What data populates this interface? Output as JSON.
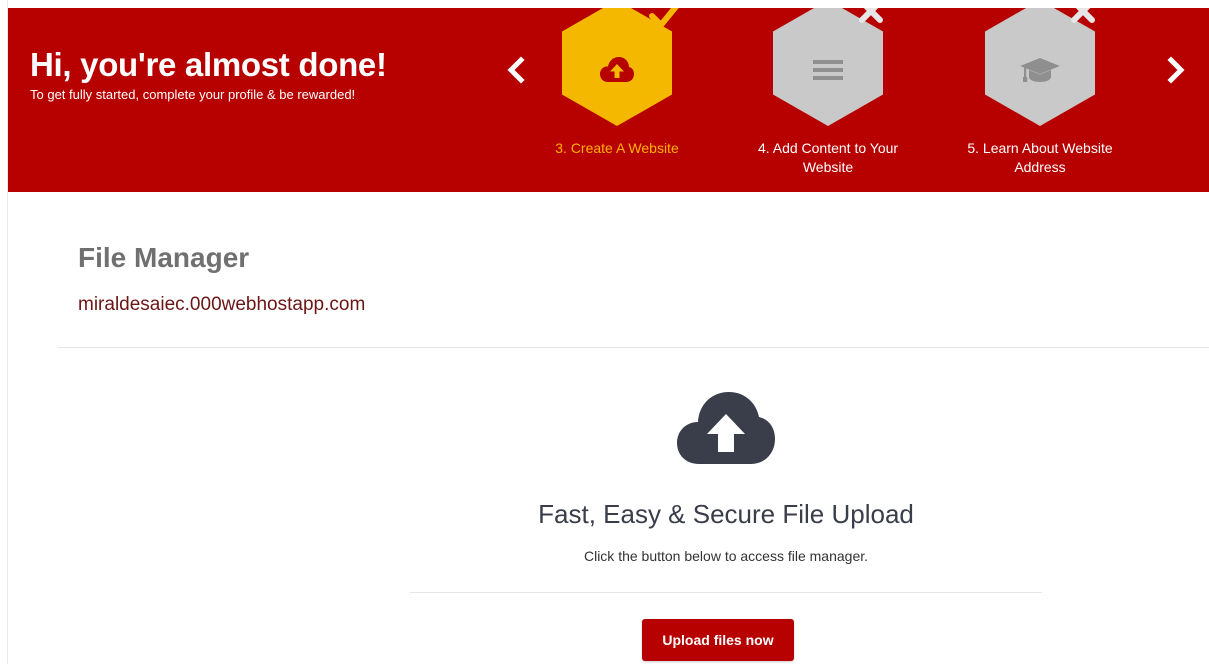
{
  "banner": {
    "title": "Hi, you're almost done!",
    "subtitle": "To get fully started, complete your profile & be rewarded!",
    "background_color": "#b70000",
    "prev_icon": "chevron-left-icon",
    "next_icon": "chevron-right-icon",
    "steps": [
      {
        "label": "3. Create A Website",
        "icon": "cloud-upload-icon",
        "status": "completed",
        "status_icon": "check-icon",
        "hex_color": "#f5b800",
        "active": true
      },
      {
        "label": "4. Add Content to Your Website",
        "icon": "menu-lines-icon",
        "status": "incomplete",
        "status_icon": "close-icon",
        "hex_color": "#c9c9c9",
        "active": false
      },
      {
        "label": "5. Learn About Website Address",
        "icon": "graduation-cap-icon",
        "status": "incomplete",
        "status_icon": "close-icon",
        "hex_color": "#c9c9c9",
        "active": false
      }
    ]
  },
  "page": {
    "title": "File Manager",
    "domain": "miraldesaiec.000webhostapp.com"
  },
  "upload": {
    "icon": "cloud-upload-icon",
    "title": "Fast, Easy & Secure File Upload",
    "description": "Click the button below to access file manager.",
    "button_label": "Upload files now",
    "button_color": "#b70000"
  }
}
